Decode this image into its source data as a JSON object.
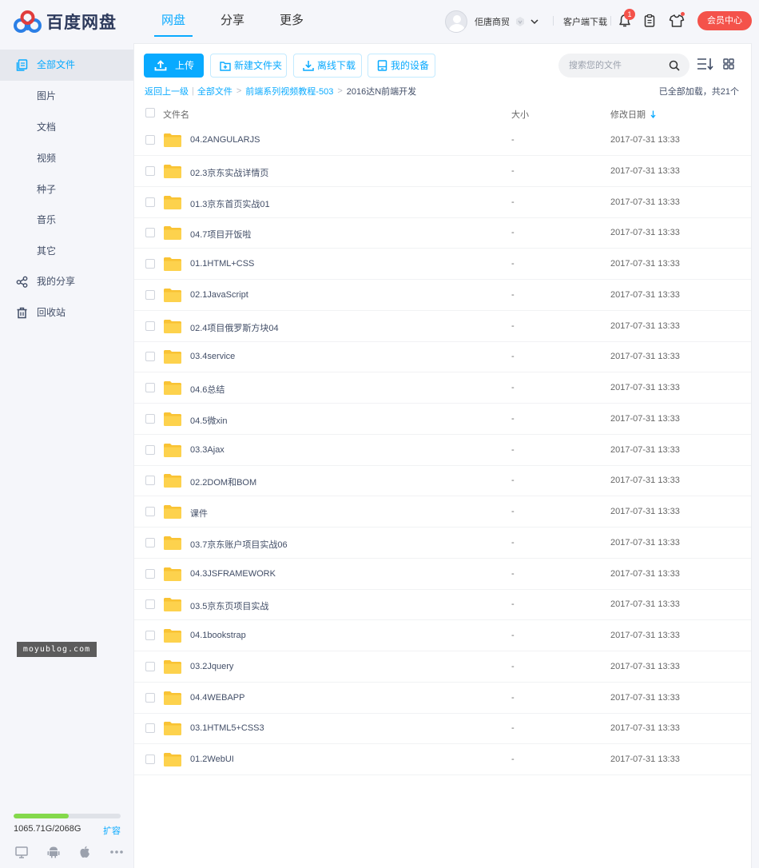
{
  "app": {
    "logo_text": "百度网盘",
    "nav": [
      {
        "label": "网盘",
        "active": true
      },
      {
        "label": "分享",
        "active": false
      },
      {
        "label": "更多",
        "active": false
      }
    ],
    "user_name": "佢唐商贸",
    "client_download": "客户端下载",
    "notification_count": "1",
    "vip_button": "会员中心",
    "accent_color": "#09aaff",
    "alert_color": "#f4524a"
  },
  "sidebar": {
    "items": [
      {
        "label": "全部文件",
        "icon": "all-files-icon",
        "active": true
      },
      {
        "label": "图片",
        "icon": "",
        "active": false
      },
      {
        "label": "文档",
        "icon": "",
        "active": false
      },
      {
        "label": "视频",
        "icon": "",
        "active": false
      },
      {
        "label": "种子",
        "icon": "",
        "active": false
      },
      {
        "label": "音乐",
        "icon": "",
        "active": false
      },
      {
        "label": "其它",
        "icon": "",
        "active": false
      },
      {
        "label": "我的分享",
        "icon": "share-icon",
        "active": false
      },
      {
        "label": "回收站",
        "icon": "trash-icon",
        "active": false
      }
    ],
    "watermark": "moyublog.com",
    "quota_text": "1065.71G/2068G",
    "quota_fraction": 0.515,
    "expand_label": "扩容",
    "platform_icons": [
      "desktop-icon",
      "android-icon",
      "apple-icon",
      "more-icon"
    ]
  },
  "toolbar": {
    "upload": "上传",
    "new_folder": "新建文件夹",
    "offline_download": "离线下载",
    "my_devices": "我的设备",
    "search_placeholder": "搜索您的文件"
  },
  "breadcrumb": {
    "back": "返回上一级",
    "items": [
      "全部文件",
      "前端系列视频教程-503"
    ],
    "current": "2016达N前端开发",
    "loaded_status": "已全部加载，共21个"
  },
  "table": {
    "columns": {
      "name": "文件名",
      "size": "大小",
      "date": "修改日期"
    },
    "rows": [
      {
        "name": "04.2ANGULARJS",
        "size": "-",
        "date": "2017-07-31 13:33"
      },
      {
        "name": "02.3京东实战详情页",
        "size": "-",
        "date": "2017-07-31 13:33"
      },
      {
        "name": "01.3京东首页实战01",
        "size": "-",
        "date": "2017-07-31 13:33"
      },
      {
        "name": "04.7项目开饭啦",
        "size": "-",
        "date": "2017-07-31 13:33"
      },
      {
        "name": "01.1HTML+CSS",
        "size": "-",
        "date": "2017-07-31 13:33"
      },
      {
        "name": "02.1JavaScript",
        "size": "-",
        "date": "2017-07-31 13:33"
      },
      {
        "name": "02.4项目俄罗斯方块04",
        "size": "-",
        "date": "2017-07-31 13:33"
      },
      {
        "name": "03.4service",
        "size": "-",
        "date": "2017-07-31 13:33"
      },
      {
        "name": "04.6总结",
        "size": "-",
        "date": "2017-07-31 13:33"
      },
      {
        "name": "04.5微xin",
        "size": "-",
        "date": "2017-07-31 13:33"
      },
      {
        "name": "03.3Ajax",
        "size": "-",
        "date": "2017-07-31 13:33"
      },
      {
        "name": "02.2DOM和BOM",
        "size": "-",
        "date": "2017-07-31 13:33"
      },
      {
        "name": "课件",
        "size": "-",
        "date": "2017-07-31 13:33"
      },
      {
        "name": "03.7京东账户项目实战06",
        "size": "-",
        "date": "2017-07-31 13:33"
      },
      {
        "name": "04.3JSFRAMEWORK",
        "size": "-",
        "date": "2017-07-31 13:33"
      },
      {
        "name": "03.5京东页项目实战",
        "size": "-",
        "date": "2017-07-31 13:33"
      },
      {
        "name": "04.1bookstrap",
        "size": "-",
        "date": "2017-07-31 13:33"
      },
      {
        "name": "03.2Jquery",
        "size": "-",
        "date": "2017-07-31 13:33"
      },
      {
        "name": "04.4WEBAPP",
        "size": "-",
        "date": "2017-07-31 13:33"
      },
      {
        "name": "03.1HTML5+CSS3",
        "size": "-",
        "date": "2017-07-31 13:33"
      },
      {
        "name": "01.2WebUI",
        "size": "-",
        "date": "2017-07-31 13:33"
      }
    ]
  }
}
